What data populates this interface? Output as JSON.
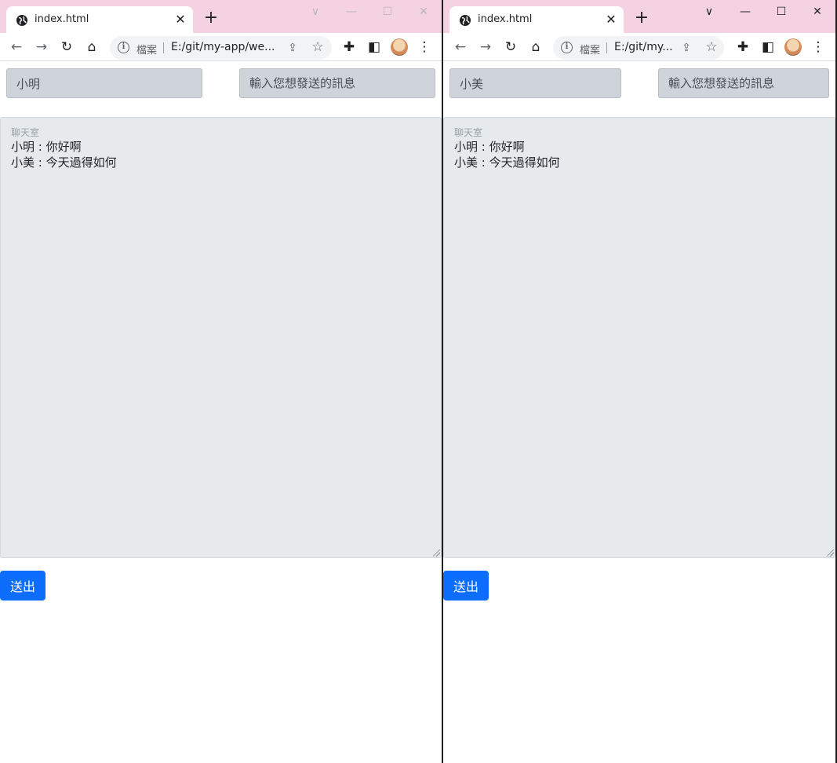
{
  "windows": [
    {
      "tab": {
        "title": "index.html"
      },
      "omnibox": {
        "scheme_label": "檔案",
        "url": "E:/git/my-app/we..."
      },
      "chat": {
        "name_value": "小明",
        "message_placeholder": "輸入您想發送的訊息",
        "room_label": "聊天室",
        "messages": [
          "小明 : 你好啊",
          "小美 : 今天過得如何"
        ]
      },
      "send_label": "送出"
    },
    {
      "tab": {
        "title": "index.html"
      },
      "omnibox": {
        "scheme_label": "檔案",
        "url": "E:/git/my..."
      },
      "chat": {
        "name_value": "小美",
        "message_placeholder": "輸入您想發送的訊息",
        "room_label": "聊天室",
        "messages": [
          "小明 : 你好啊",
          "小美 : 今天過得如何"
        ]
      },
      "send_label": "送出"
    }
  ],
  "icons": {
    "back": "arrow-back-icon",
    "forward": "arrow-forward-icon",
    "reload": "reload-icon",
    "home": "home-icon",
    "extensions": "puzzle-icon",
    "sidepanel": "side-panel-icon",
    "menu": "kebab-menu-icon"
  },
  "colors": {
    "titlebar": "#f5d2e2",
    "send_button": "#0d6efd",
    "chat_background": "#e7eaed",
    "input_background": "#ced4da"
  }
}
